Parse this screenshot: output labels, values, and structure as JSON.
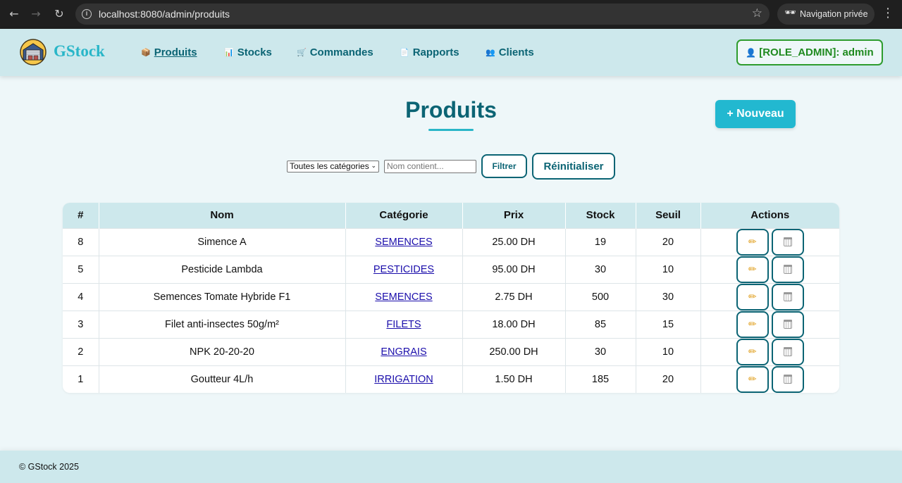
{
  "browser": {
    "url": "localhost:8080/admin/produits",
    "private_label": "Navigation privée"
  },
  "header": {
    "brand": "GStock",
    "nav": [
      {
        "icon": "📦",
        "label": "Produits",
        "active": true
      },
      {
        "icon": "📊",
        "label": "Stocks"
      },
      {
        "icon": "🛒",
        "label": "Commandes"
      },
      {
        "icon": "📄",
        "label": "Rapports"
      },
      {
        "icon": "👥",
        "label": "Clients"
      }
    ],
    "user_icon": "👤",
    "user_label": "[ROLE_ADMIN]: admin"
  },
  "main": {
    "title": "Produits",
    "new_button": "+ Nouveau",
    "filters": {
      "category_selected": "Toutes les catégories",
      "name_placeholder": "Nom contient...",
      "filter_button": "Filtrer",
      "reset_button": "Réinitialiser"
    },
    "table": {
      "headers": [
        "#",
        "Nom",
        "Catégorie",
        "Prix",
        "Stock",
        "Seuil",
        "Actions"
      ],
      "rows": [
        {
          "id": "8",
          "name": "Simence A",
          "category": "SEMENCES",
          "price": "25.00 DH",
          "stock": "19",
          "threshold": "20"
        },
        {
          "id": "5",
          "name": "Pesticide Lambda",
          "category": "PESTICIDES",
          "price": "95.00 DH",
          "stock": "30",
          "threshold": "10"
        },
        {
          "id": "4",
          "name": "Semences Tomate Hybride F1",
          "category": "SEMENCES",
          "price": "2.75 DH",
          "stock": "500",
          "threshold": "30"
        },
        {
          "id": "3",
          "name": "Filet anti-insectes 50g/m²",
          "category": "FILETS",
          "price": "18.00 DH",
          "stock": "85",
          "threshold": "15"
        },
        {
          "id": "2",
          "name": "NPK 20-20-20",
          "category": "ENGRAIS",
          "price": "250.00 DH",
          "stock": "30",
          "threshold": "10"
        },
        {
          "id": "1",
          "name": "Goutteur 4L/h",
          "category": "IRRIGATION",
          "price": "1.50 DH",
          "stock": "185",
          "threshold": "20"
        }
      ]
    }
  },
  "footer": {
    "text": "© GStock 2025"
  }
}
